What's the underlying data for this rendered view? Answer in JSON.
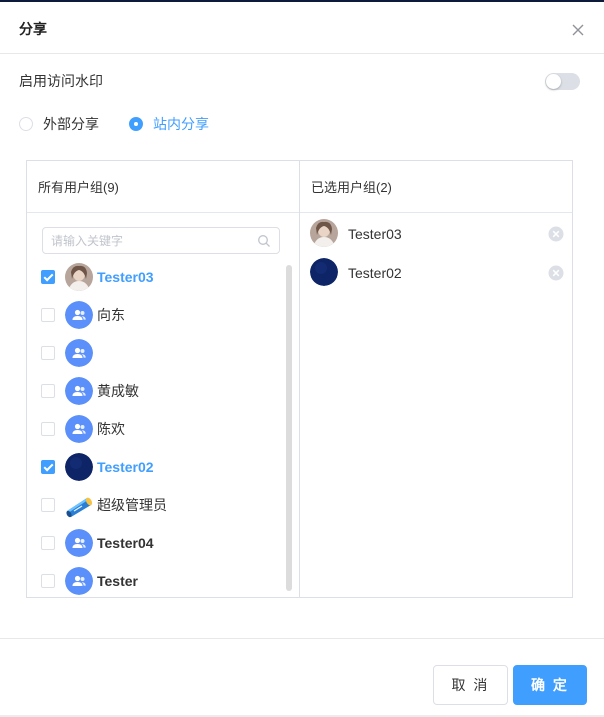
{
  "dialog": {
    "title": "分享",
    "watermark_label": "启用访问水印",
    "watermark_enabled": false
  },
  "share_mode": {
    "options": [
      {
        "label": "外部分享",
        "selected": false
      },
      {
        "label": "站内分享",
        "selected": true
      }
    ]
  },
  "groups": {
    "all_title": "所有用户组(9)",
    "search_placeholder": "请输入关键字",
    "items": [
      {
        "label": "Tester03",
        "checked": true,
        "avatar": "photo-avatar"
      },
      {
        "label": "向东",
        "checked": false,
        "avatar": "user-group-icon"
      },
      {
        "label": "",
        "checked": false,
        "avatar": "user-group-icon"
      },
      {
        "label": "黄成敏",
        "checked": false,
        "avatar": "user-group-icon"
      },
      {
        "label": "陈欢",
        "checked": false,
        "avatar": "user-group-icon"
      },
      {
        "label": "Tester02",
        "checked": true,
        "avatar": "navy-avatar"
      },
      {
        "label": "超级管理员",
        "checked": false,
        "avatar": "admin-avatar"
      },
      {
        "label": "Tester04",
        "checked": false,
        "avatar": "user-group-icon"
      },
      {
        "label": "Tester",
        "checked": false,
        "avatar": "user-group-icon"
      }
    ]
  },
  "selected": {
    "title": "已选用户组(2)",
    "items": [
      {
        "label": "Tester03",
        "avatar": "photo-avatar"
      },
      {
        "label": "Tester02",
        "avatar": "navy-avatar"
      }
    ]
  },
  "footer": {
    "cancel_label": "取 消",
    "ok_label": "确 定"
  },
  "colors": {
    "accent": "#409eff",
    "group_avatar": "#5b8ff9",
    "navy_avatar": "#0d2466"
  }
}
